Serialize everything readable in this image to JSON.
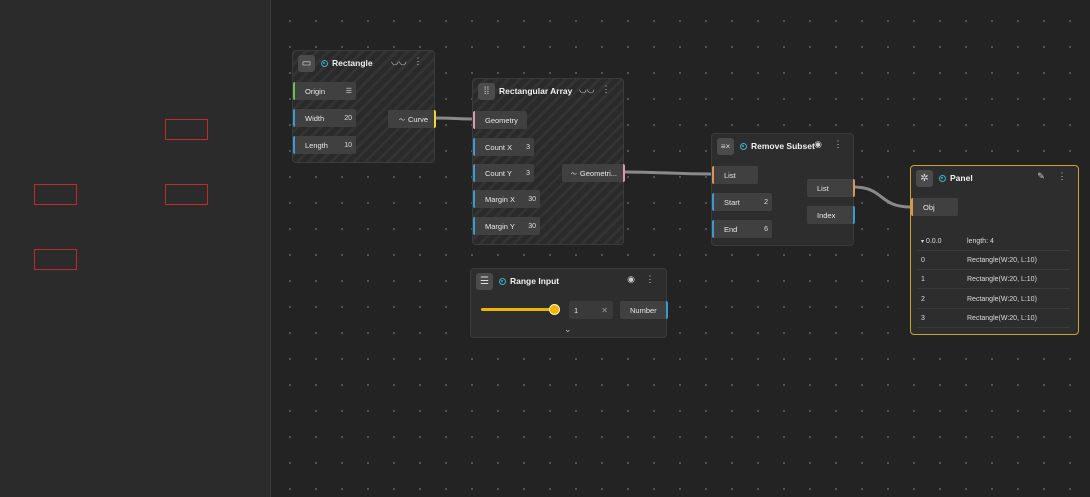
{
  "nodes": {
    "rectangle": {
      "title": "Rectangle",
      "inputs": [
        {
          "label": "Origin",
          "value": ""
        },
        {
          "label": "Width",
          "value": "20"
        },
        {
          "label": "Length",
          "value": "10"
        }
      ],
      "output": "Curve"
    },
    "rect_array": {
      "title": "Rectangular Array",
      "inputs": [
        {
          "label": "Geometry",
          "value": ""
        },
        {
          "label": "Count X",
          "value": "3"
        },
        {
          "label": "Count Y",
          "value": "3"
        },
        {
          "label": "Margin X",
          "value": "30"
        },
        {
          "label": "Margin Y",
          "value": "30"
        }
      ],
      "output": "Geometri..."
    },
    "remove_subset": {
      "title": "Remove Subset",
      "inputs": [
        {
          "label": "List",
          "value": ""
        },
        {
          "label": "Start",
          "value": "2"
        },
        {
          "label": "End",
          "value": "6"
        }
      ],
      "outputs": [
        "List",
        "Index"
      ]
    },
    "range_input": {
      "title": "Range Input",
      "value": "1",
      "output": "Number",
      "slider_fraction": 1.0
    },
    "panel": {
      "title": "Panel",
      "input": "Obj",
      "header_key": "0.0.0",
      "header_value": "length: 4",
      "rows": [
        {
          "index": "0",
          "value": "Rectangle(W:20, L:10)"
        },
        {
          "index": "1",
          "value": "Rectangle(W:20, L:10)"
        },
        {
          "index": "2",
          "value": "Rectangle(W:20, L:10)"
        },
        {
          "index": "3",
          "value": "Rectangle(W:20, L:10)"
        }
      ]
    }
  },
  "colors": {
    "wire": "#8a8a8a",
    "preview_rect": "#c02a2a",
    "panel_border": "#c8a52a",
    "slider": "#f0b400"
  },
  "icons": {
    "rectangle": "rectangle-icon",
    "rect_array": "grid-icon",
    "remove_subset": "list-remove-icon",
    "range_input": "slider-icon",
    "panel": "bug-icon"
  }
}
